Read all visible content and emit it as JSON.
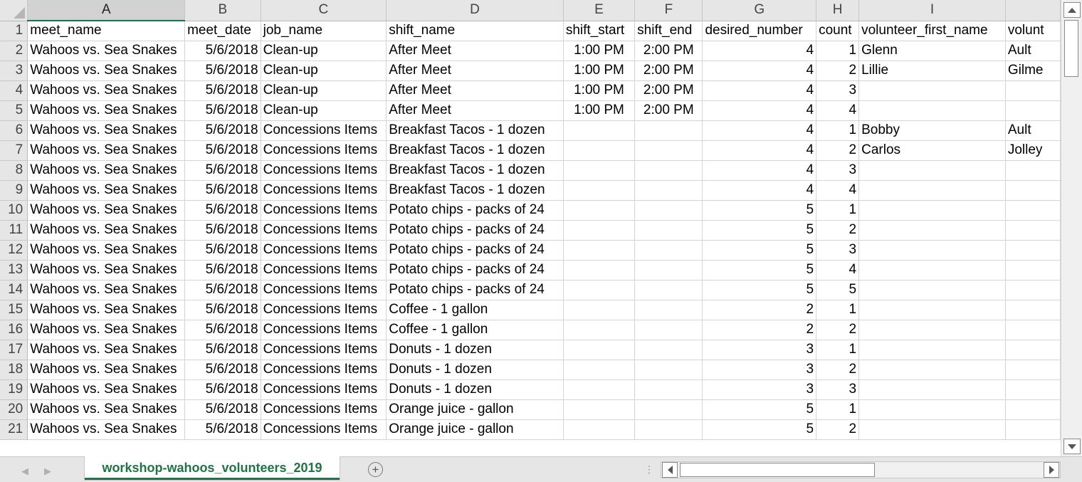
{
  "column_headers": [
    "A",
    "B",
    "C",
    "D",
    "E",
    "F",
    "G",
    "H",
    "I"
  ],
  "header_row": {
    "meet_name": "meet_name",
    "meet_date": "meet_date",
    "job_name": "job_name",
    "shift_name": "shift_name",
    "shift_start": "shift_start",
    "shift_end": "shift_end",
    "desired_number": "desired_number",
    "count": "count",
    "volunteer_first_name": "volunteer_first_name",
    "volunteer_last_name": "volunt"
  },
  "rows": [
    {
      "row": "2",
      "meet": "Wahoos vs. Sea Snakes",
      "date": "5/6/2018",
      "job": "Clean-up",
      "shift": "After Meet",
      "start": "1:00 PM",
      "end": "2:00 PM",
      "desired": "4",
      "count": "1",
      "first": "Glenn",
      "last": "Ault"
    },
    {
      "row": "3",
      "meet": "Wahoos vs. Sea Snakes",
      "date": "5/6/2018",
      "job": "Clean-up",
      "shift": "After Meet",
      "start": "1:00 PM",
      "end": "2:00 PM",
      "desired": "4",
      "count": "2",
      "first": "Lillie",
      "last": "Gilme"
    },
    {
      "row": "4",
      "meet": "Wahoos vs. Sea Snakes",
      "date": "5/6/2018",
      "job": "Clean-up",
      "shift": "After Meet",
      "start": "1:00 PM",
      "end": "2:00 PM",
      "desired": "4",
      "count": "3",
      "first": "",
      "last": ""
    },
    {
      "row": "5",
      "meet": "Wahoos vs. Sea Snakes",
      "date": "5/6/2018",
      "job": "Clean-up",
      "shift": "After Meet",
      "start": "1:00 PM",
      "end": "2:00 PM",
      "desired": "4",
      "count": "4",
      "first": "",
      "last": ""
    },
    {
      "row": "6",
      "meet": "Wahoos vs. Sea Snakes",
      "date": "5/6/2018",
      "job": "Concessions Items",
      "shift": "Breakfast Tacos - 1 dozen",
      "start": "",
      "end": "",
      "desired": "4",
      "count": "1",
      "first": "Bobby",
      "last": "Ault"
    },
    {
      "row": "7",
      "meet": "Wahoos vs. Sea Snakes",
      "date": "5/6/2018",
      "job": "Concessions Items",
      "shift": "Breakfast Tacos - 1 dozen",
      "start": "",
      "end": "",
      "desired": "4",
      "count": "2",
      "first": "Carlos",
      "last": "Jolley"
    },
    {
      "row": "8",
      "meet": "Wahoos vs. Sea Snakes",
      "date": "5/6/2018",
      "job": "Concessions Items",
      "shift": "Breakfast Tacos - 1 dozen",
      "start": "",
      "end": "",
      "desired": "4",
      "count": "3",
      "first": "",
      "last": ""
    },
    {
      "row": "9",
      "meet": "Wahoos vs. Sea Snakes",
      "date": "5/6/2018",
      "job": "Concessions Items",
      "shift": "Breakfast Tacos - 1 dozen",
      "start": "",
      "end": "",
      "desired": "4",
      "count": "4",
      "first": "",
      "last": ""
    },
    {
      "row": "10",
      "meet": "Wahoos vs. Sea Snakes",
      "date": "5/6/2018",
      "job": "Concessions Items",
      "shift": "Potato chips - packs of 24",
      "start": "",
      "end": "",
      "desired": "5",
      "count": "1",
      "first": "",
      "last": ""
    },
    {
      "row": "11",
      "meet": "Wahoos vs. Sea Snakes",
      "date": "5/6/2018",
      "job": "Concessions Items",
      "shift": "Potato chips - packs of 24",
      "start": "",
      "end": "",
      "desired": "5",
      "count": "2",
      "first": "",
      "last": ""
    },
    {
      "row": "12",
      "meet": "Wahoos vs. Sea Snakes",
      "date": "5/6/2018",
      "job": "Concessions Items",
      "shift": "Potato chips - packs of 24",
      "start": "",
      "end": "",
      "desired": "5",
      "count": "3",
      "first": "",
      "last": ""
    },
    {
      "row": "13",
      "meet": "Wahoos vs. Sea Snakes",
      "date": "5/6/2018",
      "job": "Concessions Items",
      "shift": "Potato chips - packs of 24",
      "start": "",
      "end": "",
      "desired": "5",
      "count": "4",
      "first": "",
      "last": ""
    },
    {
      "row": "14",
      "meet": "Wahoos vs. Sea Snakes",
      "date": "5/6/2018",
      "job": "Concessions Items",
      "shift": "Potato chips - packs of 24",
      "start": "",
      "end": "",
      "desired": "5",
      "count": "5",
      "first": "",
      "last": ""
    },
    {
      "row": "15",
      "meet": "Wahoos vs. Sea Snakes",
      "date": "5/6/2018",
      "job": "Concessions Items",
      "shift": "Coffee - 1 gallon",
      "start": "",
      "end": "",
      "desired": "2",
      "count": "1",
      "first": "",
      "last": ""
    },
    {
      "row": "16",
      "meet": "Wahoos vs. Sea Snakes",
      "date": "5/6/2018",
      "job": "Concessions Items",
      "shift": "Coffee - 1 gallon",
      "start": "",
      "end": "",
      "desired": "2",
      "count": "2",
      "first": "",
      "last": ""
    },
    {
      "row": "17",
      "meet": "Wahoos vs. Sea Snakes",
      "date": "5/6/2018",
      "job": "Concessions Items",
      "shift": "Donuts - 1 dozen",
      "start": "",
      "end": "",
      "desired": "3",
      "count": "1",
      "first": "",
      "last": ""
    },
    {
      "row": "18",
      "meet": "Wahoos vs. Sea Snakes",
      "date": "5/6/2018",
      "job": "Concessions Items",
      "shift": "Donuts - 1 dozen",
      "start": "",
      "end": "",
      "desired": "3",
      "count": "2",
      "first": "",
      "last": ""
    },
    {
      "row": "19",
      "meet": "Wahoos vs. Sea Snakes",
      "date": "5/6/2018",
      "job": "Concessions Items",
      "shift": "Donuts - 1 dozen",
      "start": "",
      "end": "",
      "desired": "3",
      "count": "3",
      "first": "",
      "last": ""
    },
    {
      "row": "20",
      "meet": "Wahoos vs. Sea Snakes",
      "date": "5/6/2018",
      "job": "Concessions Items",
      "shift": "Orange juice - gallon",
      "start": "",
      "end": "",
      "desired": "5",
      "count": "1",
      "first": "",
      "last": ""
    },
    {
      "row": "21",
      "meet": "Wahoos vs. Sea Snakes",
      "date": "5/6/2018",
      "job": "Concessions Items",
      "shift": "Orange juice - gallon",
      "start": "",
      "end": "",
      "desired": "5",
      "count": "2",
      "first": "",
      "last": ""
    }
  ],
  "first_row_number": "1",
  "sheet_tab": "workshop-wahoos_volunteers_2019",
  "add_sheet_symbol": "+",
  "icons": {
    "scroll_up": "triangle-up-icon",
    "scroll_down": "triangle-down-icon",
    "scroll_left": "triangle-left-icon",
    "scroll_right": "triangle-right-icon",
    "add_sheet": "plus-circle-icon"
  },
  "colors": {
    "accent": "#217346",
    "header_bg": "#e6e6e6",
    "gridline": "#d4d4d4"
  }
}
